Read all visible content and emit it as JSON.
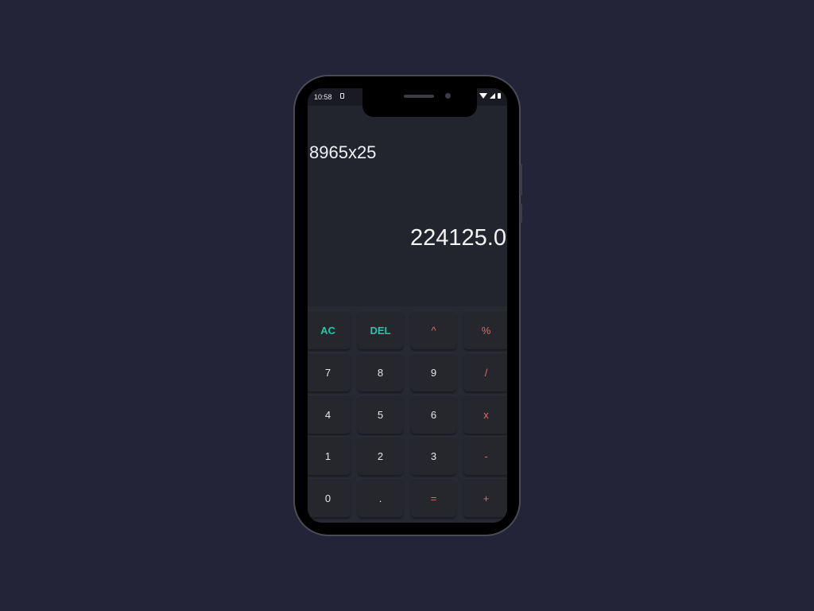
{
  "status_bar": {
    "time": "10:58"
  },
  "display": {
    "expression": "8965x25",
    "result": "224125.0"
  },
  "keypad": {
    "rows": [
      [
        {
          "label": "AC",
          "kind": "fn",
          "name": "clear-button"
        },
        {
          "label": "DEL",
          "kind": "fn",
          "name": "delete-button"
        },
        {
          "label": "^",
          "kind": "op",
          "name": "power-button"
        },
        {
          "label": "%",
          "kind": "op",
          "name": "percent-button"
        }
      ],
      [
        {
          "label": "7",
          "kind": "num",
          "name": "digit-7-button"
        },
        {
          "label": "8",
          "kind": "num",
          "name": "digit-8-button"
        },
        {
          "label": "9",
          "kind": "num",
          "name": "digit-9-button"
        },
        {
          "label": "/",
          "kind": "op",
          "name": "divide-button"
        }
      ],
      [
        {
          "label": "4",
          "kind": "num",
          "name": "digit-4-button"
        },
        {
          "label": "5",
          "kind": "num",
          "name": "digit-5-button"
        },
        {
          "label": "6",
          "kind": "num",
          "name": "digit-6-button"
        },
        {
          "label": "x",
          "kind": "op",
          "name": "multiply-button"
        }
      ],
      [
        {
          "label": "1",
          "kind": "num",
          "name": "digit-1-button"
        },
        {
          "label": "2",
          "kind": "num",
          "name": "digit-2-button"
        },
        {
          "label": "3",
          "kind": "num",
          "name": "digit-3-button"
        },
        {
          "label": "-",
          "kind": "op",
          "name": "subtract-button"
        }
      ],
      [
        {
          "label": "0",
          "kind": "num",
          "name": "digit-0-button"
        },
        {
          "label": ".",
          "kind": "num",
          "name": "decimal-button"
        },
        {
          "label": "=",
          "kind": "op",
          "name": "equals-button"
        },
        {
          "label": "+",
          "kind": "op",
          "name": "add-button"
        }
      ]
    ]
  },
  "colors": {
    "background": "#232438",
    "screen": "#23252e",
    "keypad": "#272930",
    "function_key": "#23c7a9",
    "operator_key": "#e06a6a",
    "text": "#e6e6ea"
  }
}
